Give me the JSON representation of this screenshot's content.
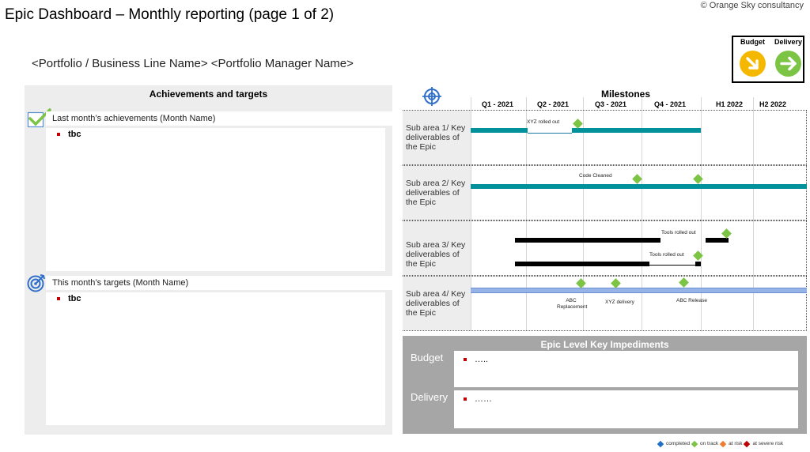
{
  "header": {
    "title": "Epic Dashboard – Monthly reporting  (page 1 of 2)",
    "copyright": "© Orange Sky consultancy",
    "portfolio": "<Portfolio / Business Line Name> <Portfolio Manager Name>"
  },
  "status": {
    "budget_label": "Budget",
    "delivery_label": "Delivery",
    "budget_color": "#f5b800",
    "delivery_color": "#7cc444"
  },
  "left": {
    "header": "Achievements and targets",
    "achievements_title": "Last month’s achievements (Month Name)",
    "achievements_item": "tbc",
    "targets_title": "This month’s targets (Month Name)",
    "targets_item": "tbc"
  },
  "milestones": {
    "title": "Milestones",
    "periods": [
      "Q1 - 2021",
      "Q2 - 2021",
      "Q3 - 2021",
      "Q4 - 2021",
      "H1 2022",
      "H2 2022"
    ],
    "rows": [
      {
        "label": "Sub area 1/ Key deliverables of the Epic",
        "milestones": [
          "XYZ  rolled out"
        ]
      },
      {
        "label": "Sub area 2/ Key deliverables of the Epic",
        "milestones": [
          "Code Cleaned"
        ]
      },
      {
        "label": "Sub area 3/ Key deliverables of the Epic",
        "milestones": [
          "Tools rolled out",
          "Tools rolled out"
        ]
      },
      {
        "label": "Sub area 4/ Key deliverables of the Epic",
        "milestones": [
          "ABC Replacement",
          "XYZ  delivery",
          "ABC  Release"
        ]
      }
    ]
  },
  "impediments": {
    "title": "Epic Level Key Impediments",
    "budget_label": "Budget",
    "budget_text": "…..",
    "delivery_label": "Delivery",
    "delivery_text": "……"
  },
  "legend": {
    "items": [
      {
        "label": "completed",
        "color": "#1f6fc9"
      },
      {
        "label": "on track",
        "color": "#7cc444"
      },
      {
        "label": "at risk",
        "color": "#ed7d31"
      },
      {
        "label": "at severe risk",
        "color": "#c00000"
      }
    ]
  },
  "colors": {
    "accent_teal": "#00919b",
    "milestone_green": "#7cc444",
    "panel_grey": "#ededed",
    "impediment_grey": "#a6a6a6",
    "bullet_red": "#c00000"
  }
}
